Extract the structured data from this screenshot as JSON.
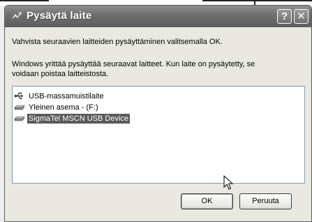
{
  "dialog": {
    "title": "Pysäytä laite",
    "help_button": "?",
    "close_button": "✕",
    "instruction": "Vahvista seuraavien laitteiden pysäyttäminen valitsemalla OK.",
    "description": "Windows yrittää pysäyttää seuraavat laitteet. Kun laite on pysäytetty, se voidaan poistaa laitteistosta.",
    "devices": [
      {
        "label": "USB-massamuistilaite",
        "icon": "usb-icon",
        "selected": false
      },
      {
        "label": "Yleinen asema - (F:)",
        "icon": "drive-icon",
        "selected": false
      },
      {
        "label": "SigmaTel MSCN USB Device",
        "icon": "drive-icon",
        "selected": true
      }
    ],
    "ok_label": "OK",
    "cancel_label": "Peruuta"
  }
}
